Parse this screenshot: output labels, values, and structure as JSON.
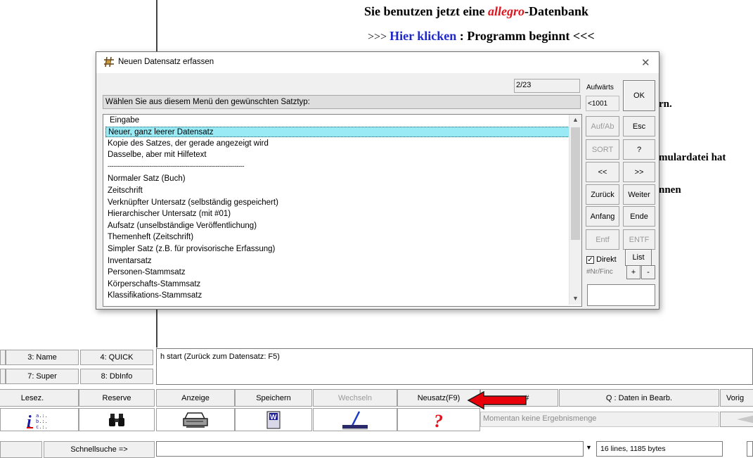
{
  "banner": {
    "line1_prefix": "Sie benutzen jetzt eine ",
    "line1_brand": "allegro",
    "line1_suffix": "-Datenbank",
    "line2_prefix": ">>> ",
    "line2_link": "Hier klicken",
    "line2_suffix": " : Programm beginnt <<<"
  },
  "background_text": {
    "frag1": "rn.",
    "frag2": "mulardatei hat",
    "frag3": "nnen"
  },
  "dialog": {
    "title": "Neuen Datensatz erfassen",
    "counter": "2/23",
    "prompt": "Wählen Sie aus diesem Menü den gewünschten Satztyp:",
    "items": [
      "Eingabe",
      "Neuer, ganz leerer Datensatz",
      "Kopie des Satzes, der gerade angezeigt wird",
      "Dasselbe, aber mit Hilfetext",
      "------------------------------------------------------------------------",
      "Normaler Satz (Buch)",
      "Zeitschrift",
      "Verknüpfter Untersatz (selbständig gespeichert)",
      "Hierarchischer Untersatz (mit #01)",
      "Aufsatz (unselbständige Veröffentlichung)",
      "Themenheft (Zeitschrift)",
      "Simpler Satz (z.B. für provisorische Erfassung)",
      "Inventarsatz",
      "Personen-Stammsatz",
      "Körperschafts-Stammsatz",
      "Klassifikations-Stammsatz"
    ],
    "side": {
      "aufwaerts": "Aufwärts",
      "lt1001": "<1001",
      "ok": "OK",
      "aufab": "Auf/Ab",
      "esc": "Esc",
      "sort": "SORT",
      "question": "?",
      "prev": "<<",
      "next": ">>",
      "zurueck": "Zurück",
      "weiter": "Weiter",
      "anfang": "Anfang",
      "ende": "Ende",
      "entf": "Entf",
      "entf_caps": "ENTF",
      "direkt": "Direkt",
      "list": "List",
      "nrfind": "#Nr/Finc",
      "plus": "+",
      "minus": "-"
    }
  },
  "bottom": {
    "btn_name": "3: Name",
    "btn_quick": "4: QUICK",
    "btn_super": "7: Super",
    "btn_dbinfo": "8: DbInfo",
    "status_text": "h start  (Zurück zum Datensatz: F5)",
    "row3": [
      "Lesez.",
      "Reserve",
      "Anzeige",
      "Speichern",
      "Wechseln",
      "Neusatz(F9)",
      "n. #",
      "Q : Daten in Bearb.",
      "Vorig"
    ],
    "result_text": "Momentan keine Ergebnismenge",
    "quicksearch": "Schnellsuche =>",
    "lines_info": "16 lines, 1185 bytes"
  },
  "colors": {
    "link_blue": "#1f28c8",
    "brand_red": "#e0141e",
    "selection": "#99eaf5",
    "arrow_red": "#e8000b"
  }
}
